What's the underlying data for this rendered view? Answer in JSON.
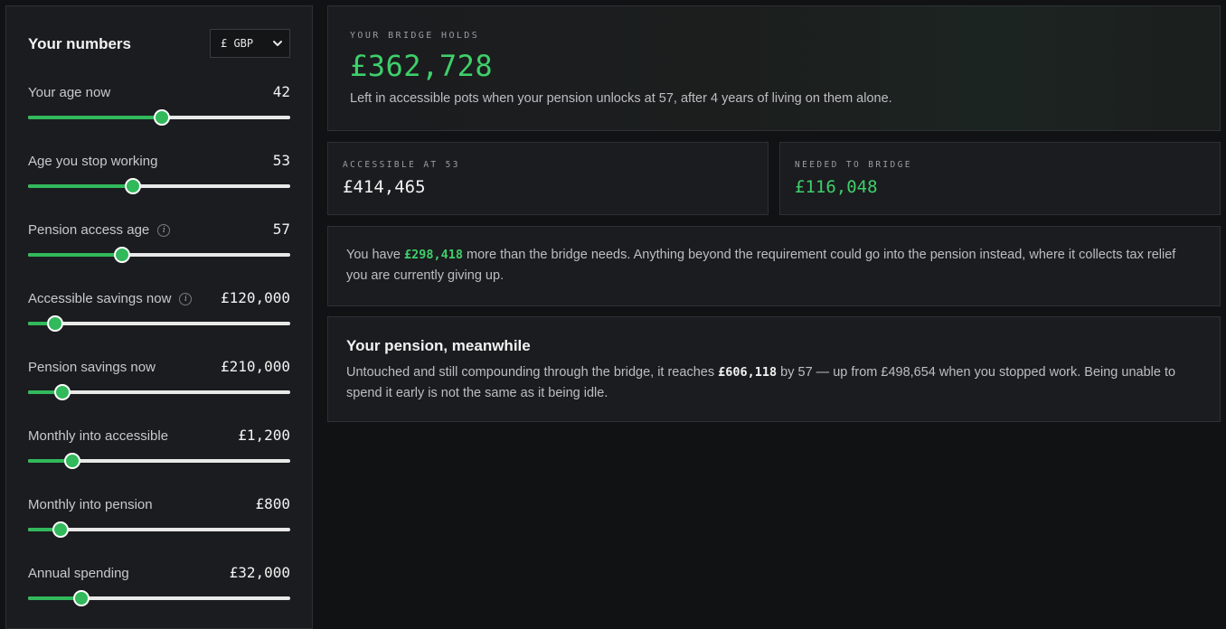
{
  "sidebar": {
    "title": "Your numbers",
    "currency": "£ GBP",
    "fields": [
      {
        "label": "Your age now",
        "value": "42",
        "fill_fraction": 0.51,
        "has_info": false
      },
      {
        "label": "Age you stop working",
        "value": "53",
        "fill_fraction": 0.4,
        "has_info": false
      },
      {
        "label": "Pension access age",
        "value": "57",
        "fill_fraction": 0.36,
        "has_info": true
      },
      {
        "label": "Accessible savings now",
        "value": "£120,000",
        "fill_fraction": 0.105,
        "has_info": true
      },
      {
        "label": "Pension savings now",
        "value": "£210,000",
        "fill_fraction": 0.13,
        "has_info": false
      },
      {
        "label": "Monthly into accessible",
        "value": "£1,200",
        "fill_fraction": 0.17,
        "has_info": false
      },
      {
        "label": "Monthly into pension",
        "value": "£800",
        "fill_fraction": 0.125,
        "has_info": false
      },
      {
        "label": "Annual spending",
        "value": "£32,000",
        "fill_fraction": 0.205,
        "has_info": false
      }
    ]
  },
  "hero": {
    "eyebrow": "YOUR BRIDGE HOLDS",
    "amount": "£362,728",
    "description": "Left in accessible pots when your pension unlocks at 57, after 4 years of living on them alone."
  },
  "stats": {
    "accessible": {
      "label": "ACCESSIBLE AT 53",
      "value": "£414,465"
    },
    "needed": {
      "label": "NEEDED TO BRIDGE",
      "value": "£116,048"
    }
  },
  "note": {
    "prefix": "You have ",
    "surplus": "£298,418",
    "suffix": " more than the bridge needs. Anything beyond the requirement could go into the pension instead, where it collects tax relief you are currently giving up."
  },
  "pension": {
    "title": "Your pension, meanwhile",
    "text_before": "Untouched and still compounding through the bridge, it reaches ",
    "amount": "£606,118",
    "text_after": " by 57 — up from £498,654 when you stopped work. Being unable to spend it early is not the same as it being idle."
  },
  "colors": {
    "accent": "#3ecf6b",
    "slider_fill": "#31b95b",
    "card_bg": "#1b1c1f",
    "page_bg": "#111214"
  },
  "icons": {
    "info": "info-icon",
    "dropdown": "chevron-down-icon"
  }
}
